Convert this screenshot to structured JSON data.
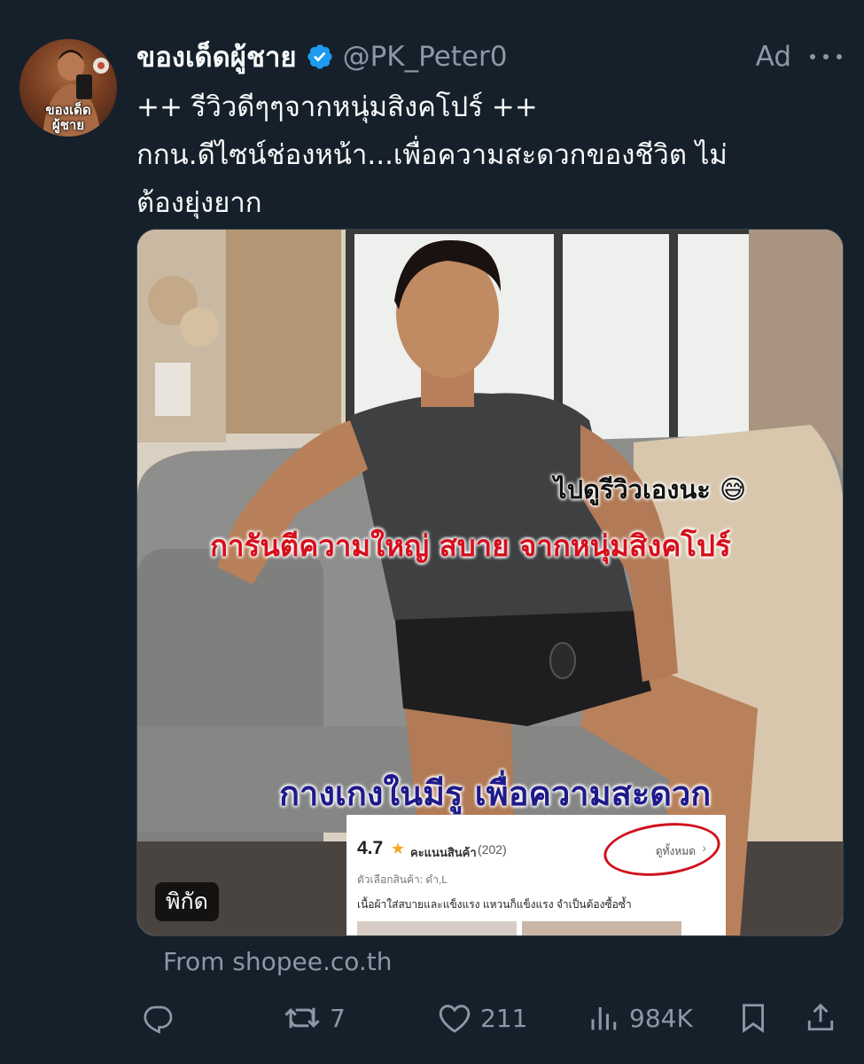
{
  "tweet": {
    "avatar_text_line1": "ของเด็ด",
    "avatar_text_line2": "ผู้ชาย",
    "display_name": "ของเด็ดผู้ชาย",
    "handle": "@PK_Peter0",
    "ad_label": "Ad",
    "text_lines": [
      "++ รีวิวดีๆๆจากหนุ่มสิงคโปร์ ++",
      "กกน.ดีไซน์ช่องหน้า...เพื่อความสะดวกของชีวิต ไม่",
      "ต้องยุ่งยาก"
    ]
  },
  "media": {
    "caption_small": "ไปดูรีวิวเองนะ 😅",
    "caption_red": "การันตีความใหญ่ สบาย จากหนุ่มสิงคโปร์",
    "caption_blue": "กางเกงในมีรู เพื่อความสะดวก",
    "review_card": {
      "rating": "4.7",
      "star": "★",
      "score_label": "คะแนนสินค้า",
      "count": "(202)",
      "view_all": "ดูทั้งหมด",
      "chevron": "›",
      "option": "ตัวเลือกสินค้า: ดำ,L",
      "review": "เนื้อผ้าใส่สบายและแข็งแรง แหวนก็แข็งแรง จำเป็นต้องซื้อซ้ำ"
    },
    "location_badge": "พิกัด"
  },
  "source": "From shopee.co.th",
  "actions": {
    "reply_icon": "reply-icon",
    "retweet_count": "7",
    "like_count": "211",
    "views_count": "984K",
    "bookmark_icon": "bookmark-icon",
    "share_icon": "share-icon"
  },
  "colors": {
    "background": "#15202b",
    "text_primary": "#f7f9f9",
    "text_secondary": "#8b98a5",
    "verified_blue": "#1d9bf0",
    "caption_red": "#d60f1c",
    "caption_blue": "#1f1a8a"
  }
}
